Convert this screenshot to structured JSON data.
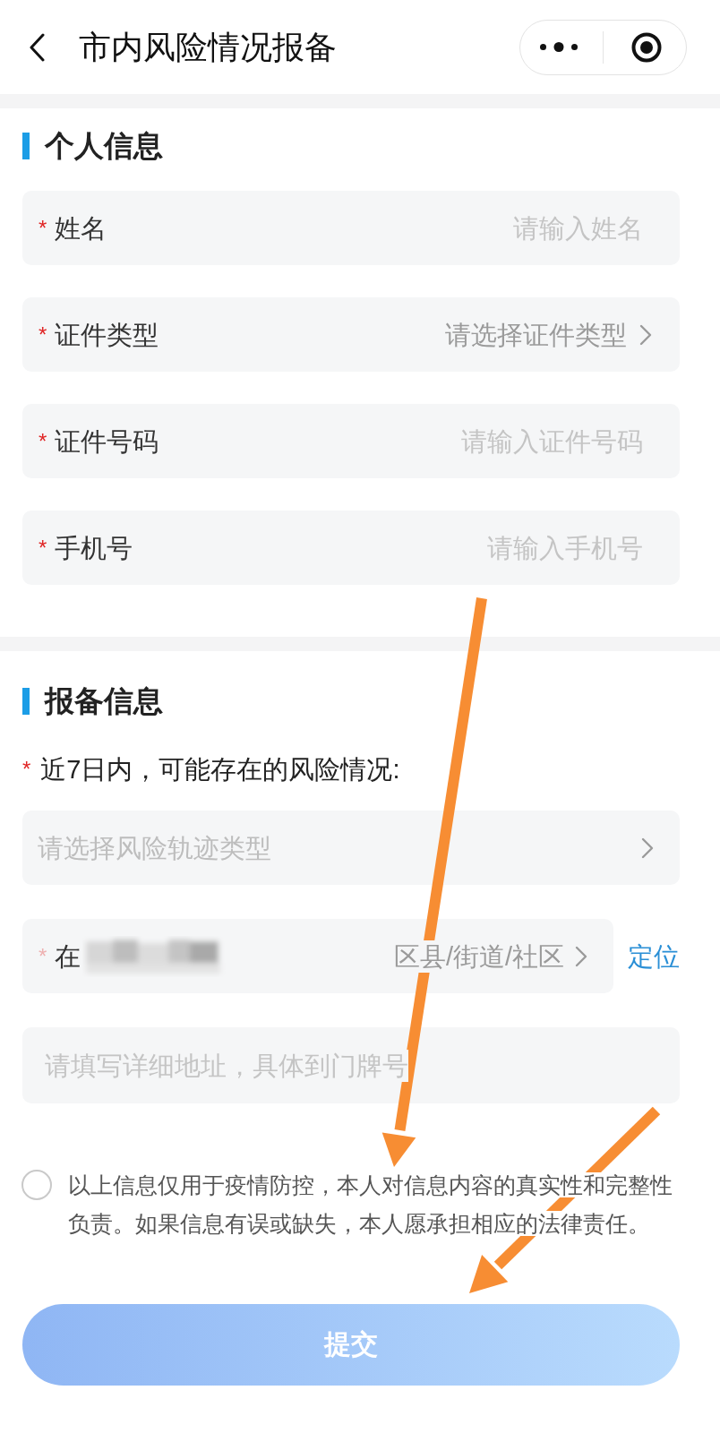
{
  "header": {
    "title": "市内风险情况报备"
  },
  "sections": [
    {
      "title": "个人信息",
      "fields": [
        {
          "kind": "input",
          "required_mark": "*",
          "label": "姓名",
          "placeholder": "请输入姓名"
        },
        {
          "kind": "picker",
          "required_mark": "*",
          "label": "证件类型",
          "placeholder": "请选择证件类型"
        },
        {
          "kind": "input",
          "required_mark": "*",
          "label": "证件号码",
          "placeholder": "请输入证件号码"
        },
        {
          "kind": "input",
          "required_mark": "*",
          "label": "手机号",
          "placeholder": "请输入手机号"
        }
      ]
    },
    {
      "title": "报备信息",
      "question": {
        "required_mark": "*",
        "text": "近7日内，可能存在的风险情况:"
      },
      "fields": [
        {
          "kind": "select",
          "placeholder": "请选择风险轨迹类型"
        },
        {
          "kind": "location",
          "required_mark": "*",
          "label": "在",
          "placeholder": "区县/街道/社区",
          "action": "定位"
        },
        {
          "kind": "textarea",
          "placeholder": "请填写详细地址，具体到门牌号"
        }
      ]
    }
  ],
  "agreement": {
    "checked": false,
    "text": "以上信息仅用于疫情防控，本人对信息内容的真实性和完整性负责。如果信息有误或缺失，本人愿承担相应的法律责任。"
  },
  "submit": {
    "label": "提交",
    "disabled": true
  }
}
